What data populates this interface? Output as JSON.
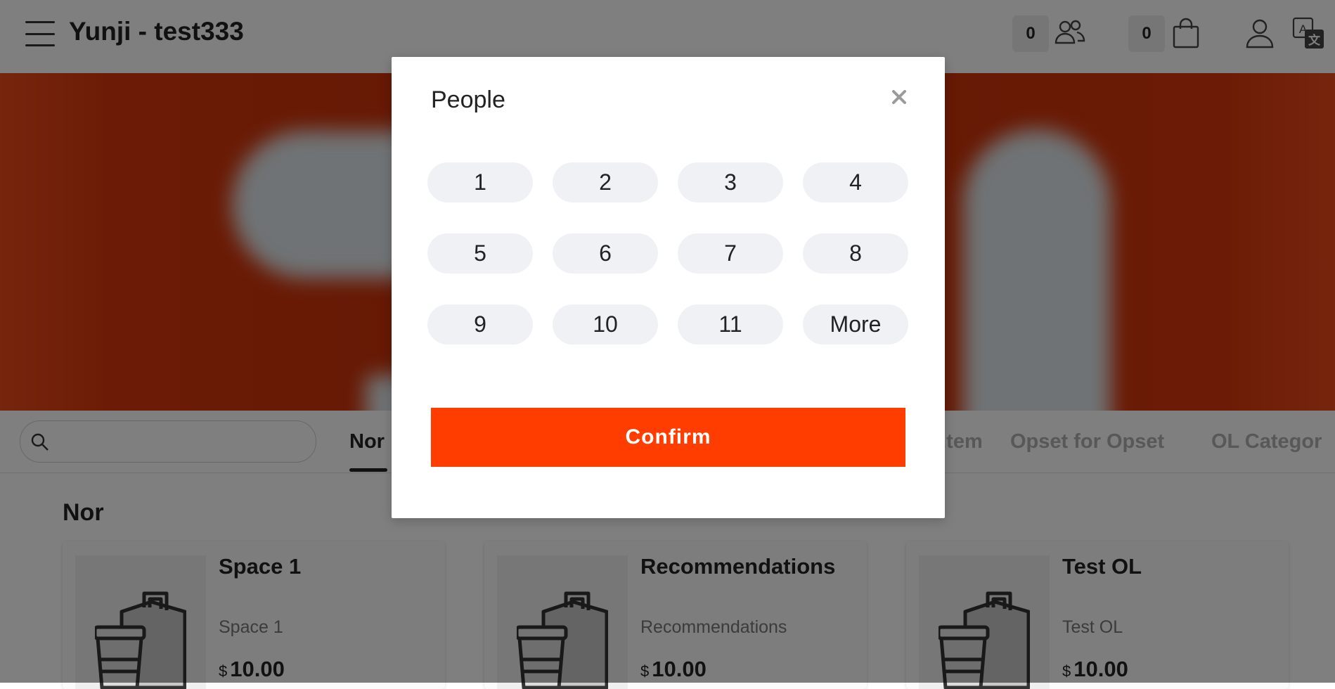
{
  "header": {
    "store_title": "Yunji - test333",
    "people_count": "0",
    "cart_count": "0",
    "icons": [
      "menu-icon",
      "people-icon",
      "shopping-bag-icon",
      "user-icon",
      "translate-icon"
    ]
  },
  "search": {
    "placeholder": ""
  },
  "categories": {
    "tabs": [
      "Nor",
      "...tem",
      "Opset for Opset",
      "OL Categor"
    ],
    "active_index": 0
  },
  "section": {
    "title": "Nor"
  },
  "products": [
    {
      "name": "Space 1",
      "description": "Space 1",
      "currency": "$",
      "price": "10.00"
    },
    {
      "name": "Recommendations",
      "description": "Recommendations",
      "currency": "$",
      "price": "10.00"
    },
    {
      "name": "Test OL",
      "description": "Test OL",
      "currency": "$",
      "price": "10.00"
    }
  ],
  "modal": {
    "title": "People",
    "options": [
      "1",
      "2",
      "3",
      "4",
      "5",
      "6",
      "7",
      "8",
      "9",
      "10",
      "11",
      "More"
    ],
    "confirm_label": "Confirm"
  },
  "colors": {
    "accent": "#ff3d00",
    "banner": "#c73108",
    "overlay": "rgba(0,0,0,0.5)",
    "option_bg": "#f0f1f5"
  }
}
